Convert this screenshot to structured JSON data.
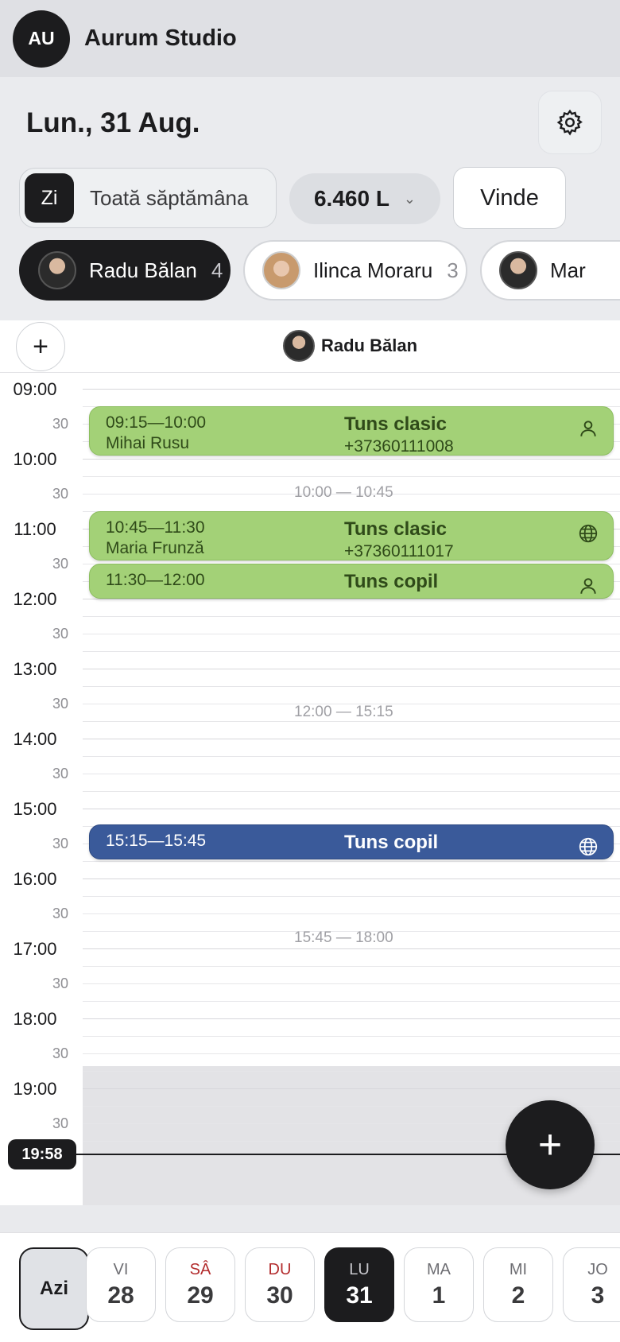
{
  "topbar": {
    "avatar": "AU",
    "studio_name": "Aurum Studio"
  },
  "header": {
    "date": "Lun., 31 Aug.",
    "view_day": "Zi",
    "view_week": "Toată săptămâna",
    "amount": "6.460 L",
    "sell": "Vinde"
  },
  "staff": [
    {
      "name": "Radu Bălan",
      "count": "4",
      "active": true
    },
    {
      "name": "Ilinca Moraru",
      "count": "3",
      "active": false
    },
    {
      "name": "Mar",
      "count": "",
      "active": false
    }
  ],
  "calendar": {
    "column_title": "Radu Bălan",
    "hours": [
      "09:00",
      "10:00",
      "11:00",
      "12:00",
      "13:00",
      "14:00",
      "15:00",
      "16:00",
      "17:00",
      "18:00",
      "19:00"
    ],
    "half_label": "30",
    "free_slots": [
      "10:00 — 10:45",
      "12:00 — 15:15",
      "15:45 — 18:00"
    ],
    "appointments": [
      {
        "time": "09:15—10:00",
        "client": "Mihai Rusu",
        "service": "Tuns clasic",
        "phone": "+37360111008",
        "icon": "person-icon"
      },
      {
        "time": "10:45—11:30",
        "client": "Maria Frunză",
        "service": "Tuns clasic",
        "phone": "+37360111017",
        "icon": "globe-icon"
      },
      {
        "time": "11:30—12:00",
        "client": "",
        "service": "Tuns copil",
        "phone": "",
        "icon": "person-icon"
      },
      {
        "time": "15:15—15:45",
        "client": "",
        "service": "Tuns copil",
        "phone": "",
        "icon": "globe-icon"
      }
    ],
    "now": "19:58"
  },
  "days": {
    "today_label": "Azi",
    "items": [
      {
        "name": "VI",
        "num": "28"
      },
      {
        "name": "SÂ",
        "num": "29"
      },
      {
        "name": "DU",
        "num": "30"
      },
      {
        "name": "LU",
        "num": "31"
      },
      {
        "name": "MA",
        "num": "1"
      },
      {
        "name": "MI",
        "num": "2"
      },
      {
        "name": "JO",
        "num": "3"
      }
    ]
  },
  "colors": {
    "booked_online": "#3a5a9a",
    "booked": "#a3d177",
    "weekend": "#b32d2e"
  }
}
